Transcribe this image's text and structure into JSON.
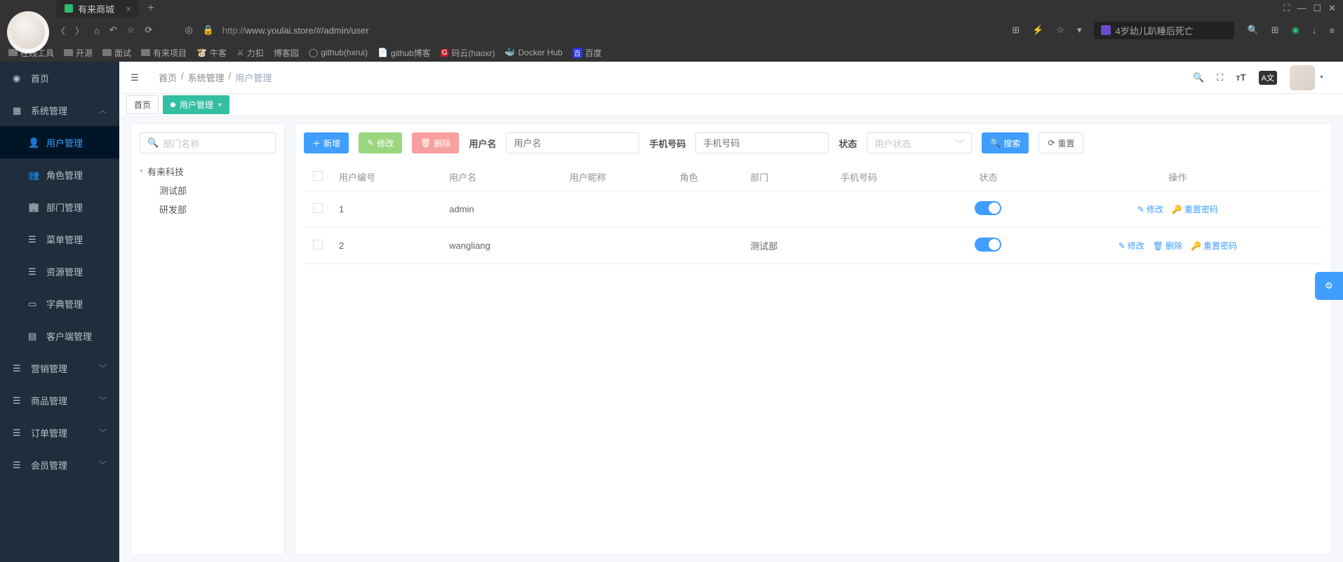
{
  "browser": {
    "tab_title": "有来商城",
    "url_prefix": "http://",
    "url": "www.youlai.store/#/admin/user",
    "news": "4岁幼儿趴睡后死亡",
    "bookmarks": [
      "在线工具",
      "开源",
      "面试",
      "有来项目",
      "牛客",
      "力扣",
      "博客园",
      "github(hxrui)",
      "github博客",
      "码云(haoxr)",
      "Docker Hub",
      "百度"
    ],
    "window_controls": [
      "⛶",
      "—",
      "☐",
      "✕"
    ]
  },
  "sidebar": {
    "items": [
      {
        "label": "首页"
      },
      {
        "label": "系统管理",
        "open": true
      },
      {
        "label": "营销管理"
      },
      {
        "label": "商品管理"
      },
      {
        "label": "订单管理"
      },
      {
        "label": "会员管理"
      }
    ],
    "sub_system": [
      "用户管理",
      "角色管理",
      "部门管理",
      "菜单管理",
      "资源管理",
      "字典管理",
      "客户端管理"
    ]
  },
  "topbar": {
    "crumbs": [
      "首页",
      "系统管理",
      "用户管理"
    ],
    "tabs": [
      {
        "label": "首页",
        "active": false
      },
      {
        "label": "用户管理",
        "active": true
      }
    ]
  },
  "panel": {
    "dept_search_placeholder": "部门名称",
    "btn_add": "新增",
    "btn_edit": "修改",
    "btn_del": "删除",
    "label_username": "用户名",
    "ph_username": "用户名",
    "label_phone": "手机号码",
    "ph_phone": "手机号码",
    "label_status": "状态",
    "ph_status": "用户状态",
    "btn_search": "搜索",
    "btn_reset": "重置",
    "tree_root": "有来科技",
    "tree_children": [
      "测试部",
      "研发部"
    ]
  },
  "table": {
    "cols": [
      "用户编号",
      "用户名",
      "用户昵称",
      "角色",
      "部门",
      "手机号码",
      "状态",
      "操作"
    ],
    "rows": [
      {
        "id": "1",
        "username": "admin",
        "nickname": "",
        "role": "",
        "dept": "",
        "phone": "",
        "status": true,
        "actions": [
          "修改",
          "重置密码"
        ]
      },
      {
        "id": "2",
        "username": "wangliang",
        "nickname": "",
        "role": "",
        "dept": "测试部",
        "phone": "",
        "status": true,
        "actions": [
          "修改",
          "删除",
          "重置密码"
        ]
      }
    ],
    "act_edit": "修改",
    "act_delete": "删除",
    "act_reset": "重置密码"
  }
}
